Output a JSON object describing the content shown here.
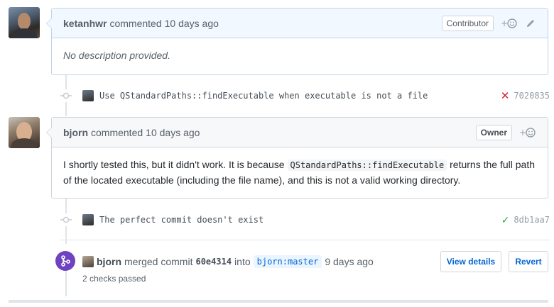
{
  "comment1": {
    "author": "ketanhwr",
    "action": "commented",
    "time": "10 days ago",
    "role": "Contributor",
    "body": "No description provided."
  },
  "commit1": {
    "message": "Use QStandardPaths::findExecutable when executable is not a file",
    "sha": "7020835",
    "status": "failure"
  },
  "comment2": {
    "author": "bjorn",
    "action": "commented",
    "time": "10 days ago",
    "role": "Owner",
    "body_part1": "I shortly tested this, but it didn't work. It is because",
    "body_code": "QStandardPaths::findExecutable",
    "body_part2": "returns the full path of the located executable (including the file name), and this is not a valid working directory."
  },
  "commit2": {
    "message": "The perfect commit doesn't exist",
    "sha": "8db1aa7",
    "status": "success"
  },
  "merge": {
    "author": "bjorn",
    "action": "merged commit",
    "sha": "60e4314",
    "into": "into",
    "branch": "bjorn:master",
    "time": "9 days ago",
    "checks": "2 checks passed",
    "view_details_label": "View details",
    "revert_label": "Revert"
  },
  "colors": {
    "accent": "#0366d6",
    "merge_purple": "#6f42c1",
    "failure_red": "#cb2431",
    "success_green": "#28a745",
    "contributor_header_bg": "#f1f8ff"
  }
}
